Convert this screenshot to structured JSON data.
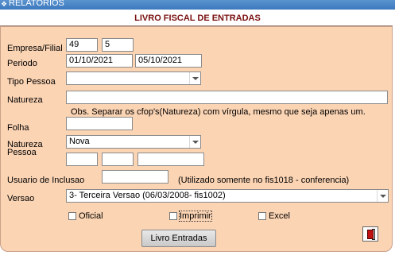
{
  "window": {
    "title": "RELATORIOS",
    "arrow_glyph": "❖"
  },
  "form": {
    "heading": "LIVRO FISCAL DE ENTRADAS",
    "empresa_filial": {
      "label": "Empresa/Filial",
      "empresa": "49",
      "filial": "5"
    },
    "periodo": {
      "label": "Periodo",
      "inicio": "01/10/2021",
      "fim": "05/10/2021"
    },
    "tipo_pessoa": {
      "label": "Tipo Pessoa",
      "selected": ""
    },
    "natureza": {
      "label": "Natureza",
      "value": "",
      "obs": "Obs. Separar os cfop's(Natureza) com vírgula, mesmo que seja  apenas um."
    },
    "folha": {
      "label": "Folha",
      "value": ""
    },
    "natureza_pessoa": {
      "label_line1": "Natureza",
      "label_line2": "Pessoa",
      "selected": "Nova",
      "field1": "",
      "field2": "",
      "field3": ""
    },
    "usuario_inclusao": {
      "label": "Usuario de Inclusao",
      "value": "",
      "note": "(Utilizado somente  no fis1018 - conferencia)"
    },
    "versao": {
      "label": "Versao",
      "selected": "3- Terceira Versao (06/03/2008- fis1002)"
    },
    "options": {
      "oficial": "Oficial",
      "imprimir": "Imprimir",
      "excel": "Excel"
    },
    "submit_label": "Livro Entradas"
  }
}
